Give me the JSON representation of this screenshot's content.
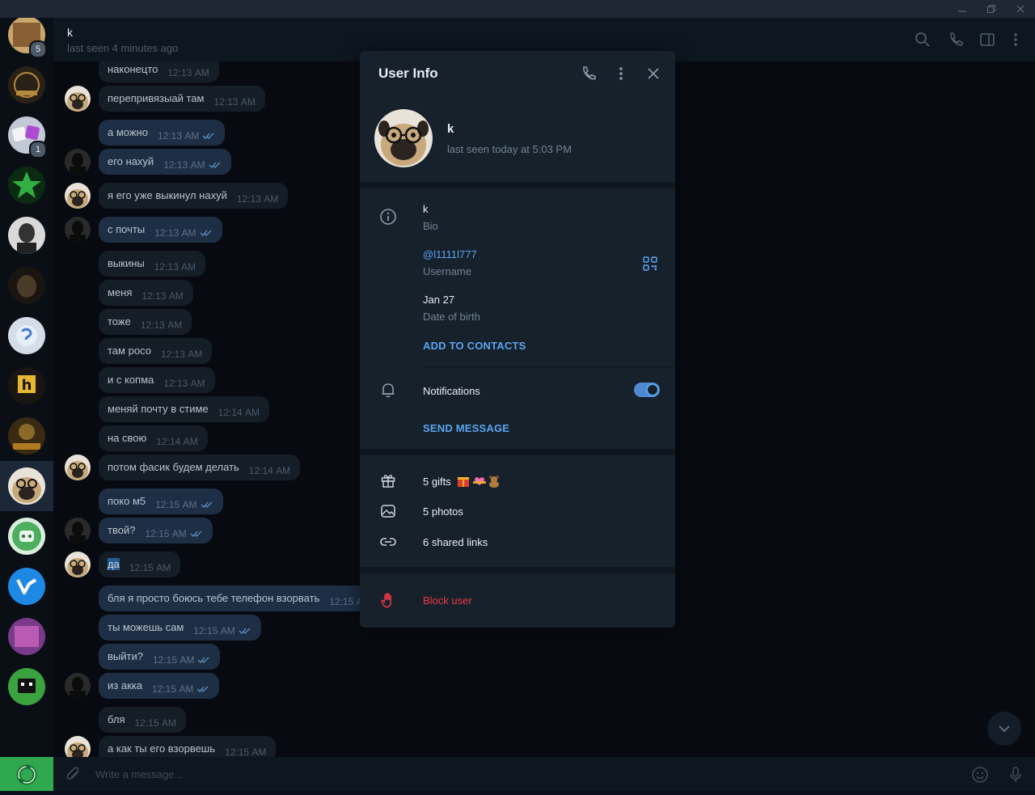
{
  "header": {
    "peer_name": "k",
    "peer_status": "last seen 4 minutes ago"
  },
  "chat_list": {
    "items": [
      {
        "badge": "5"
      },
      {
        "badge": ""
      },
      {
        "badge": "1"
      },
      {
        "badge": ""
      },
      {
        "badge": ""
      },
      {
        "badge": ""
      },
      {
        "badge": ""
      },
      {
        "badge": ""
      },
      {
        "badge": ""
      },
      {
        "badge": ""
      },
      {
        "badge": ""
      },
      {
        "badge": ""
      },
      {
        "badge": ""
      },
      {
        "badge": ""
      }
    ]
  },
  "messages": [
    {
      "text": "наконецто",
      "time": "12:13 AM",
      "dir": "in",
      "avatar": false
    },
    {
      "text": "перепривязыай там",
      "time": "12:13 AM",
      "dir": "in",
      "avatar": "pug"
    },
    {
      "text": "а можно",
      "time": "12:13 AM",
      "dir": "out",
      "avatar": false
    },
    {
      "text": "его нахуй",
      "time": "12:13 AM",
      "dir": "out",
      "avatar": "dark"
    },
    {
      "text": "я его уже выкинул нахуй",
      "time": "12:13 AM",
      "dir": "in",
      "avatar": "pug"
    },
    {
      "text": "с почты",
      "time": "12:13 AM",
      "dir": "out",
      "avatar": "dark"
    },
    {
      "text": "выкины",
      "time": "12:13 AM",
      "dir": "in",
      "avatar": false
    },
    {
      "text": "меня",
      "time": "12:13 AM",
      "dir": "in",
      "avatar": false
    },
    {
      "text": "тоже",
      "time": "12:13 AM",
      "dir": "in",
      "avatar": false
    },
    {
      "text": "там росо",
      "time": "12:13 AM",
      "dir": "in",
      "avatar": false
    },
    {
      "text": "и с копма",
      "time": "12:13 AM",
      "dir": "in",
      "avatar": false
    },
    {
      "text": "меняй почту в стиме",
      "time": "12:14 AM",
      "dir": "in",
      "avatar": false
    },
    {
      "text": "на свою",
      "time": "12:14 AM",
      "dir": "in",
      "avatar": false
    },
    {
      "text": "потом фасик будем делать",
      "time": "12:14 AM",
      "dir": "in",
      "avatar": "pug"
    },
    {
      "text": "поко м5",
      "time": "12:15 AM",
      "dir": "out",
      "avatar": false
    },
    {
      "text": "твой?",
      "time": "12:15 AM",
      "dir": "out",
      "avatar": "dark"
    },
    {
      "text": "да",
      "time": "12:15 AM",
      "dir": "in",
      "avatar": "pug"
    },
    {
      "text": "бля я просто боюсь тебе телефон взорвать",
      "time": "12:15 AM",
      "dir": "out",
      "avatar": false
    },
    {
      "text": "ты можешь сам",
      "time": "12:15 AM",
      "dir": "out",
      "avatar": false
    },
    {
      "text": "выйти?",
      "time": "12:15 AM",
      "dir": "out",
      "avatar": false
    },
    {
      "text": "из акка",
      "time": "12:15 AM",
      "dir": "out",
      "avatar": "dark"
    },
    {
      "text": "бля",
      "time": "12:15 AM",
      "dir": "in",
      "avatar": false
    },
    {
      "text": "а как ты его взорвешь",
      "time": "12:15 AM",
      "dir": "in",
      "avatar": "pug"
    }
  ],
  "composer": {
    "placeholder": "Write a message..."
  },
  "user_info": {
    "title": "User Info",
    "name": "k",
    "status": "last seen today at 5:03 PM",
    "bio_value": "k",
    "bio_label": "Bio",
    "username_value": "@l1111l777",
    "username_label": "Username",
    "dob_value": "Jan 27",
    "dob_label": "Date of birth",
    "add_contacts": "ADD TO CONTACTS",
    "notifications_label": "Notifications",
    "notifications_on": true,
    "send_message": "SEND MESSAGE",
    "gifts": "5 gifts",
    "photos": "5 photos",
    "links": "6 shared links",
    "block_user": "Block user"
  },
  "colors": {
    "accent": "#5aa5f0",
    "danger": "#ec3942",
    "panel_bg": "#17212b",
    "out_bubble": "#1e2f45",
    "in_bubble": "#151d27"
  }
}
